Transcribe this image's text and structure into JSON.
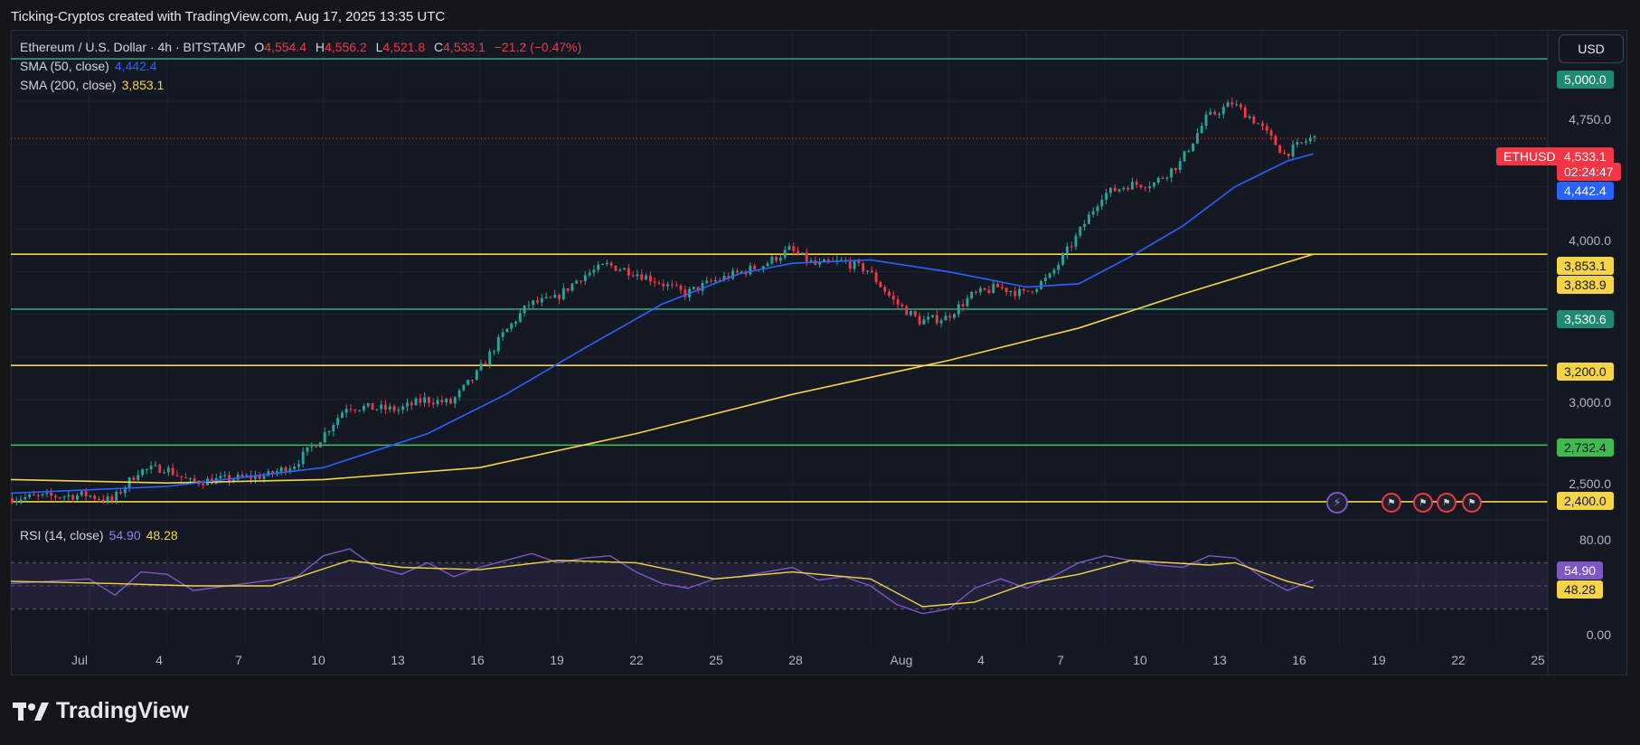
{
  "caption": "Ticking-Cryptos created with TradingView.com, Aug 17, 2025 13:35 UTC",
  "legend": {
    "symbol": "Ethereum / U.S. Dollar · 4h · BITSTAMP",
    "o_label": "O",
    "o_value": "4,554.4",
    "h_label": "H",
    "h_value": "4,556.2",
    "l_label": "L",
    "l_value": "4,521.8",
    "c_label": "C",
    "c_value": "4,533.1",
    "change": "−21.2 (−0.47%)",
    "sma50_label": "SMA (50, close)",
    "sma50_value": "4,442.4",
    "sma200_label": "SMA (200, close)",
    "sma200_value": "3,853.1",
    "rsi_label": "RSI (14, close)",
    "rsi_value": "54.90",
    "rsi_ma_value": "48.28"
  },
  "currency_button": "USD",
  "brand": "TradingView",
  "symbol_tag": "ETHUSD",
  "price_labels": {
    "last_price": "4,533.1",
    "countdown": "02:24:47",
    "sma50": "4,442.4",
    "sma200": "3,853.1",
    "level_3838": "3,838.9",
    "level_5000": "5,000.0",
    "level_3530": "3,530.6",
    "level_3200": "3,200.0",
    "level_2732": "2,732.4",
    "level_2400": "2,400.0",
    "rsi": "54.90",
    "rsi_ma": "48.28"
  },
  "price_ticks": [
    "4,750.0",
    "4,000.0",
    "3,000.0",
    "2,500.0"
  ],
  "rsi_ticks": [
    "80.00",
    "0.00"
  ],
  "date_ticks": [
    "Jul",
    "4",
    "7",
    "10",
    "13",
    "16",
    "19",
    "22",
    "25",
    "28",
    "Aug",
    "4",
    "7",
    "10",
    "13",
    "16",
    "19",
    "22",
    "25"
  ],
  "colors": {
    "up": "#26a69a",
    "down": "#f23645",
    "sma50": "#2962ff",
    "sma200": "#f5d547",
    "rsi": "#7e57c2",
    "rsi_ma": "#f5d547",
    "yellow_level": "#f5d547",
    "green_level": "#2e9e7e",
    "lime_level": "#3fb950"
  },
  "icons": {
    "event_flags": "us-flag-icon",
    "lightning": "lightning-icon",
    "logo": "tradingview-logo-icon"
  },
  "chart_data": {
    "type": "candlestick",
    "interval": "4h",
    "x_range": [
      "2025-06-28",
      "2025-08-26"
    ],
    "y_range": [
      2320,
      5080
    ],
    "y_scale": "linear",
    "grid": true,
    "horizontal_levels": [
      {
        "price": 5000.0,
        "color": "teal"
      },
      {
        "price": 3853.1,
        "color": "yellow"
      },
      {
        "price": 3530.6,
        "color": "teal"
      },
      {
        "price": 3200.0,
        "color": "yellow"
      },
      {
        "price": 2732.4,
        "color": "green"
      },
      {
        "price": 2400.0,
        "color": "yellow"
      }
    ],
    "price_path": [
      [
        "2025-06-28",
        2420
      ],
      [
        "2025-07-01",
        2440
      ],
      [
        "2025-07-02",
        2405
      ],
      [
        "2025-07-03",
        2580
      ],
      [
        "2025-07-04",
        2600
      ],
      [
        "2025-07-05",
        2515
      ],
      [
        "2025-07-07",
        2540
      ],
      [
        "2025-07-08",
        2555
      ],
      [
        "2025-07-09",
        2620
      ],
      [
        "2025-07-10",
        2770
      ],
      [
        "2025-07-11",
        2960
      ],
      [
        "2025-07-12",
        2950
      ],
      [
        "2025-07-13",
        2940
      ],
      [
        "2025-07-14",
        3000
      ],
      [
        "2025-07-15",
        2980
      ],
      [
        "2025-07-16",
        3150
      ],
      [
        "2025-07-17",
        3380
      ],
      [
        "2025-07-18",
        3560
      ],
      [
        "2025-07-19",
        3590
      ],
      [
        "2025-07-20",
        3720
      ],
      [
        "2025-07-21",
        3790
      ],
      [
        "2025-07-22",
        3750
      ],
      [
        "2025-07-23",
        3690
      ],
      [
        "2025-07-24",
        3620
      ],
      [
        "2025-07-25",
        3690
      ],
      [
        "2025-07-26",
        3740
      ],
      [
        "2025-07-27",
        3790
      ],
      [
        "2025-07-28",
        3880
      ],
      [
        "2025-07-29",
        3790
      ],
      [
        "2025-07-30",
        3810
      ],
      [
        "2025-07-31",
        3760
      ],
      [
        "2025-08-01",
        3580
      ],
      [
        "2025-08-02",
        3460
      ],
      [
        "2025-08-03",
        3480
      ],
      [
        "2025-08-04",
        3610
      ],
      [
        "2025-08-05",
        3660
      ],
      [
        "2025-08-06",
        3620
      ],
      [
        "2025-08-07",
        3720
      ],
      [
        "2025-08-08",
        3950
      ],
      [
        "2025-08-09",
        4200
      ],
      [
        "2025-08-10",
        4260
      ],
      [
        "2025-08-11",
        4270
      ],
      [
        "2025-08-12",
        4390
      ],
      [
        "2025-08-13",
        4650
      ],
      [
        "2025-08-14",
        4740
      ],
      [
        "2025-08-15",
        4620
      ],
      [
        "2025-08-16",
        4440
      ],
      [
        "2025-08-17",
        4533.1
      ]
    ],
    "sma50_path": [
      [
        "2025-06-28",
        2450
      ],
      [
        "2025-07-04",
        2490
      ],
      [
        "2025-07-10",
        2600
      ],
      [
        "2025-07-14",
        2800
      ],
      [
        "2025-07-17",
        3030
      ],
      [
        "2025-07-20",
        3300
      ],
      [
        "2025-07-23",
        3560
      ],
      [
        "2025-07-26",
        3740
      ],
      [
        "2025-07-28",
        3800
      ],
      [
        "2025-07-31",
        3820
      ],
      [
        "2025-08-03",
        3750
      ],
      [
        "2025-08-06",
        3660
      ],
      [
        "2025-08-08",
        3680
      ],
      [
        "2025-08-10",
        3840
      ],
      [
        "2025-08-12",
        4020
      ],
      [
        "2025-08-14",
        4250
      ],
      [
        "2025-08-16",
        4400
      ],
      [
        "2025-08-17",
        4442.4
      ]
    ],
    "sma200_path": [
      [
        "2025-06-28",
        2530
      ],
      [
        "2025-07-04",
        2510
      ],
      [
        "2025-07-10",
        2530
      ],
      [
        "2025-07-16",
        2600
      ],
      [
        "2025-07-22",
        2800
      ],
      [
        "2025-07-28",
        3030
      ],
      [
        "2025-08-03",
        3230
      ],
      [
        "2025-08-08",
        3420
      ],
      [
        "2025-08-12",
        3620
      ],
      [
        "2025-08-17",
        3853.1
      ]
    ],
    "rsi": {
      "ylim": [
        0,
        100
      ],
      "ticks": [
        80,
        0
      ],
      "band": [
        30,
        70
      ],
      "last": 54.9,
      "ma_last": 48.28,
      "rsi_path": [
        [
          "2025-06-28",
          52
        ],
        [
          "2025-07-01",
          56
        ],
        [
          "2025-07-02",
          42
        ],
        [
          "2025-07-03",
          62
        ],
        [
          "2025-07-04",
          60
        ],
        [
          "2025-07-05",
          46
        ],
        [
          "2025-07-07",
          52
        ],
        [
          "2025-07-09",
          58
        ],
        [
          "2025-07-10",
          76
        ],
        [
          "2025-07-11",
          82
        ],
        [
          "2025-07-12",
          66
        ],
        [
          "2025-07-13",
          60
        ],
        [
          "2025-07-14",
          70
        ],
        [
          "2025-07-15",
          58
        ],
        [
          "2025-07-16",
          66
        ],
        [
          "2025-07-17",
          72
        ],
        [
          "2025-07-18",
          78
        ],
        [
          "2025-07-19",
          70
        ],
        [
          "2025-07-20",
          74
        ],
        [
          "2025-07-21",
          76
        ],
        [
          "2025-07-22",
          62
        ],
        [
          "2025-07-23",
          52
        ],
        [
          "2025-07-24",
          48
        ],
        [
          "2025-07-25",
          56
        ],
        [
          "2025-07-26",
          58
        ],
        [
          "2025-07-27",
          62
        ],
        [
          "2025-07-28",
          66
        ],
        [
          "2025-07-29",
          55
        ],
        [
          "2025-07-30",
          58
        ],
        [
          "2025-07-31",
          50
        ],
        [
          "2025-08-01",
          34
        ],
        [
          "2025-08-02",
          26
        ],
        [
          "2025-08-03",
          30
        ],
        [
          "2025-08-04",
          48
        ],
        [
          "2025-08-05",
          56
        ],
        [
          "2025-08-06",
          48
        ],
        [
          "2025-08-07",
          58
        ],
        [
          "2025-08-08",
          70
        ],
        [
          "2025-08-09",
          76
        ],
        [
          "2025-08-10",
          72
        ],
        [
          "2025-08-11",
          68
        ],
        [
          "2025-08-12",
          66
        ],
        [
          "2025-08-13",
          76
        ],
        [
          "2025-08-14",
          74
        ],
        [
          "2025-08-15",
          58
        ],
        [
          "2025-08-16",
          46
        ],
        [
          "2025-08-17",
          54.9
        ]
      ],
      "ma_path": [
        [
          "2025-06-28",
          54
        ],
        [
          "2025-07-02",
          52
        ],
        [
          "2025-07-05",
          50
        ],
        [
          "2025-07-08",
          50
        ],
        [
          "2025-07-11",
          72
        ],
        [
          "2025-07-13",
          66
        ],
        [
          "2025-07-16",
          64
        ],
        [
          "2025-07-19",
          72
        ],
        [
          "2025-07-22",
          70
        ],
        [
          "2025-07-25",
          56
        ],
        [
          "2025-07-28",
          62
        ],
        [
          "2025-07-31",
          56
        ],
        [
          "2025-08-02",
          32
        ],
        [
          "2025-08-04",
          36
        ],
        [
          "2025-08-06",
          52
        ],
        [
          "2025-08-08",
          60
        ],
        [
          "2025-08-10",
          72
        ],
        [
          "2025-08-13",
          68
        ],
        [
          "2025-08-14",
          70
        ],
        [
          "2025-08-16",
          54
        ],
        [
          "2025-08-17",
          48.28
        ]
      ]
    }
  }
}
